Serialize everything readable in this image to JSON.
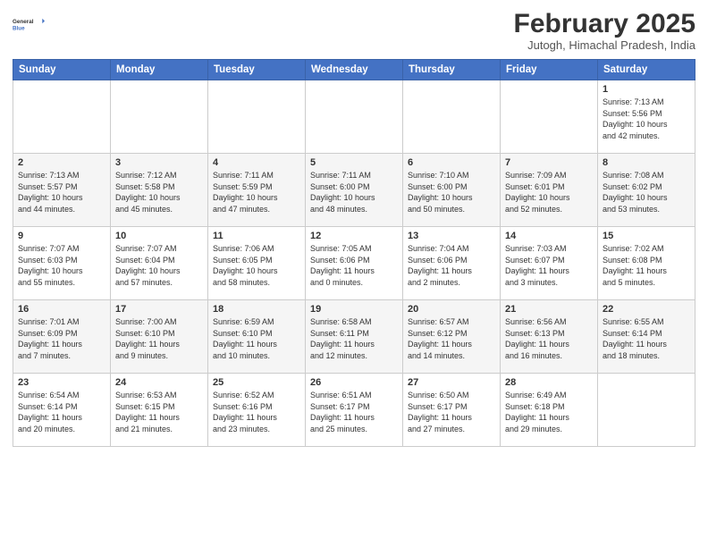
{
  "logo": {
    "general": "General",
    "blue": "Blue"
  },
  "header": {
    "month_title": "February 2025",
    "location": "Jutogh, Himachal Pradesh, India"
  },
  "weekdays": [
    "Sunday",
    "Monday",
    "Tuesday",
    "Wednesday",
    "Thursday",
    "Friday",
    "Saturday"
  ],
  "weeks": [
    [
      {
        "day": "",
        "info": ""
      },
      {
        "day": "",
        "info": ""
      },
      {
        "day": "",
        "info": ""
      },
      {
        "day": "",
        "info": ""
      },
      {
        "day": "",
        "info": ""
      },
      {
        "day": "",
        "info": ""
      },
      {
        "day": "1",
        "info": "Sunrise: 7:13 AM\nSunset: 5:56 PM\nDaylight: 10 hours\nand 42 minutes."
      }
    ],
    [
      {
        "day": "2",
        "info": "Sunrise: 7:13 AM\nSunset: 5:57 PM\nDaylight: 10 hours\nand 44 minutes."
      },
      {
        "day": "3",
        "info": "Sunrise: 7:12 AM\nSunset: 5:58 PM\nDaylight: 10 hours\nand 45 minutes."
      },
      {
        "day": "4",
        "info": "Sunrise: 7:11 AM\nSunset: 5:59 PM\nDaylight: 10 hours\nand 47 minutes."
      },
      {
        "day": "5",
        "info": "Sunrise: 7:11 AM\nSunset: 6:00 PM\nDaylight: 10 hours\nand 48 minutes."
      },
      {
        "day": "6",
        "info": "Sunrise: 7:10 AM\nSunset: 6:00 PM\nDaylight: 10 hours\nand 50 minutes."
      },
      {
        "day": "7",
        "info": "Sunrise: 7:09 AM\nSunset: 6:01 PM\nDaylight: 10 hours\nand 52 minutes."
      },
      {
        "day": "8",
        "info": "Sunrise: 7:08 AM\nSunset: 6:02 PM\nDaylight: 10 hours\nand 53 minutes."
      }
    ],
    [
      {
        "day": "9",
        "info": "Sunrise: 7:07 AM\nSunset: 6:03 PM\nDaylight: 10 hours\nand 55 minutes."
      },
      {
        "day": "10",
        "info": "Sunrise: 7:07 AM\nSunset: 6:04 PM\nDaylight: 10 hours\nand 57 minutes."
      },
      {
        "day": "11",
        "info": "Sunrise: 7:06 AM\nSunset: 6:05 PM\nDaylight: 10 hours\nand 58 minutes."
      },
      {
        "day": "12",
        "info": "Sunrise: 7:05 AM\nSunset: 6:06 PM\nDaylight: 11 hours\nand 0 minutes."
      },
      {
        "day": "13",
        "info": "Sunrise: 7:04 AM\nSunset: 6:06 PM\nDaylight: 11 hours\nand 2 minutes."
      },
      {
        "day": "14",
        "info": "Sunrise: 7:03 AM\nSunset: 6:07 PM\nDaylight: 11 hours\nand 3 minutes."
      },
      {
        "day": "15",
        "info": "Sunrise: 7:02 AM\nSunset: 6:08 PM\nDaylight: 11 hours\nand 5 minutes."
      }
    ],
    [
      {
        "day": "16",
        "info": "Sunrise: 7:01 AM\nSunset: 6:09 PM\nDaylight: 11 hours\nand 7 minutes."
      },
      {
        "day": "17",
        "info": "Sunrise: 7:00 AM\nSunset: 6:10 PM\nDaylight: 11 hours\nand 9 minutes."
      },
      {
        "day": "18",
        "info": "Sunrise: 6:59 AM\nSunset: 6:10 PM\nDaylight: 11 hours\nand 10 minutes."
      },
      {
        "day": "19",
        "info": "Sunrise: 6:58 AM\nSunset: 6:11 PM\nDaylight: 11 hours\nand 12 minutes."
      },
      {
        "day": "20",
        "info": "Sunrise: 6:57 AM\nSunset: 6:12 PM\nDaylight: 11 hours\nand 14 minutes."
      },
      {
        "day": "21",
        "info": "Sunrise: 6:56 AM\nSunset: 6:13 PM\nDaylight: 11 hours\nand 16 minutes."
      },
      {
        "day": "22",
        "info": "Sunrise: 6:55 AM\nSunset: 6:14 PM\nDaylight: 11 hours\nand 18 minutes."
      }
    ],
    [
      {
        "day": "23",
        "info": "Sunrise: 6:54 AM\nSunset: 6:14 PM\nDaylight: 11 hours\nand 20 minutes."
      },
      {
        "day": "24",
        "info": "Sunrise: 6:53 AM\nSunset: 6:15 PM\nDaylight: 11 hours\nand 21 minutes."
      },
      {
        "day": "25",
        "info": "Sunrise: 6:52 AM\nSunset: 6:16 PM\nDaylight: 11 hours\nand 23 minutes."
      },
      {
        "day": "26",
        "info": "Sunrise: 6:51 AM\nSunset: 6:17 PM\nDaylight: 11 hours\nand 25 minutes."
      },
      {
        "day": "27",
        "info": "Sunrise: 6:50 AM\nSunset: 6:17 PM\nDaylight: 11 hours\nand 27 minutes."
      },
      {
        "day": "28",
        "info": "Sunrise: 6:49 AM\nSunset: 6:18 PM\nDaylight: 11 hours\nand 29 minutes."
      },
      {
        "day": "",
        "info": ""
      }
    ]
  ]
}
